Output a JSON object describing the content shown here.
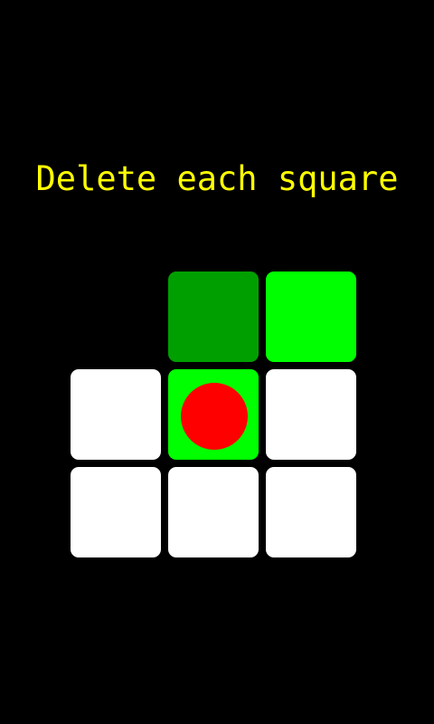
{
  "instruction": "Delete each square",
  "colors": {
    "background": "#000000",
    "instruction_text": "#ffff00",
    "tile_white": "#ffffff",
    "tile_dark_green": "#009f00",
    "tile_bright_green": "#00ff00",
    "player_red": "#ff0000"
  },
  "grid": {
    "rows": 3,
    "cols": 3,
    "cells": [
      [
        "empty",
        "dark-green",
        "bright-green"
      ],
      [
        "white",
        "bright-green-current",
        "white"
      ],
      [
        "white",
        "white",
        "white"
      ]
    ]
  },
  "player": {
    "row": 1,
    "col": 1,
    "icon": "red-circle"
  }
}
